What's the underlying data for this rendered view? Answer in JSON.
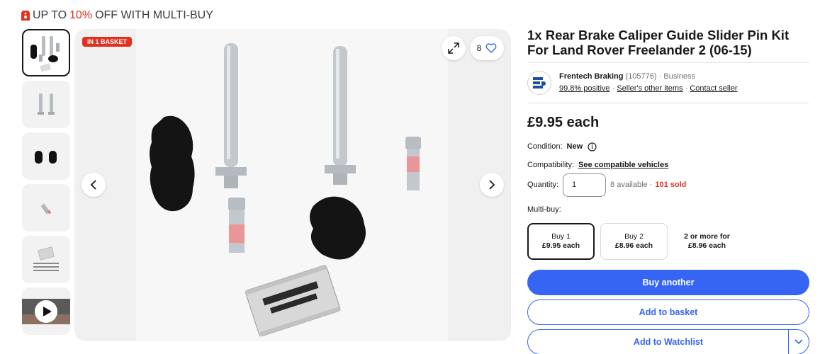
{
  "promo": {
    "prefix": "UP TO",
    "percent": "10%",
    "suffix": "OFF WITH MULTI-BUY"
  },
  "gallery": {
    "badge": "IN 1 BASKET",
    "watch_count": "8",
    "thumbnails": [
      "brake-kit-full",
      "guide-pins",
      "rubber-boots",
      "bolt",
      "grease-sachet",
      "video"
    ]
  },
  "item": {
    "title": "1x Rear Brake Caliper Guide Slider Pin Kit For Land Rover Freelander 2 (06-15)"
  },
  "seller": {
    "name": "Frentech Braking",
    "feedback_count": "(105776)",
    "type": "· Business",
    "positive": "99.8% positive",
    "sep": "·",
    "other_items": "Seller's other items",
    "contact": "Contact seller"
  },
  "price": "£9.95 each",
  "condition": {
    "label": "Condition:",
    "value": "New"
  },
  "compatibility": {
    "label": "Compatibility:",
    "link": "See compatible vehicles"
  },
  "quantity": {
    "label": "Quantity:",
    "value": "1",
    "available": "8 available ·",
    "sold": "101 sold"
  },
  "multibuy": {
    "label": "Multi-buy:",
    "options": [
      {
        "line1": "Buy 1",
        "line2": "£9.95 each"
      },
      {
        "line1": "Buy 2",
        "line2": "£8.96 each"
      },
      {
        "line1": "2 or more for",
        "line2": "£8.96 each"
      }
    ]
  },
  "buttons": {
    "buy": "Buy another",
    "basket": "Add to basket",
    "watchlist": "Add to Watchlist"
  },
  "colors": {
    "accent": "#3665f3",
    "sale": "#e0301e"
  }
}
